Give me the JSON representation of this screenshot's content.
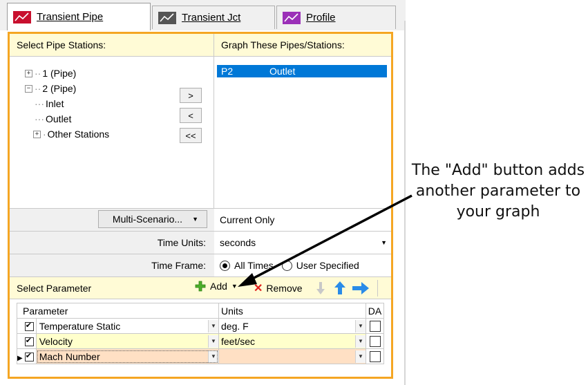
{
  "tabs": [
    {
      "label": "Transient Pipe",
      "active": true
    },
    {
      "label": "Transient Jct",
      "active": false
    },
    {
      "label": "Profile",
      "active": false
    }
  ],
  "select_stations": {
    "header": "Select Pipe Stations:",
    "tree": [
      "1 (Pipe)",
      "2 (Pipe)",
      "Inlet",
      "Outlet",
      "Other Stations"
    ],
    "buttons": [
      ">",
      "<",
      "<<"
    ]
  },
  "graph_pipes": {
    "header": "Graph These Pipes/Stations:",
    "selected_pipe": "P2",
    "selected_station": "Outlet"
  },
  "scenario": {
    "button": "Multi-Scenario...",
    "value": "Current Only"
  },
  "time_units": {
    "label": "Time Units:",
    "value": "seconds"
  },
  "time_frame": {
    "label": "Time Frame:",
    "options": [
      "All Times",
      "User Specified"
    ],
    "selected": "All Times"
  },
  "parameter_toolbar": {
    "label": "Select Parameter",
    "add": "Add",
    "remove": "Remove"
  },
  "grid": {
    "columns": [
      "Parameter",
      "Units",
      "DA"
    ],
    "rows": [
      {
        "checked": true,
        "parameter": "Temperature Static",
        "units": "deg. F",
        "da": false
      },
      {
        "checked": true,
        "parameter": "Velocity",
        "units": "feet/sec",
        "da": false
      },
      {
        "checked": true,
        "parameter": "Mach Number",
        "units": "",
        "da": false
      }
    ]
  },
  "annotation": {
    "text": "The \"Add\" button adds another parameter to your graph"
  },
  "colors": {
    "accent_border": "#f5a623",
    "header_bg": "#fffbd6",
    "selection": "#0078d7",
    "row_yellow": "#ffffcc",
    "row_orange": "#ffe0c4"
  }
}
